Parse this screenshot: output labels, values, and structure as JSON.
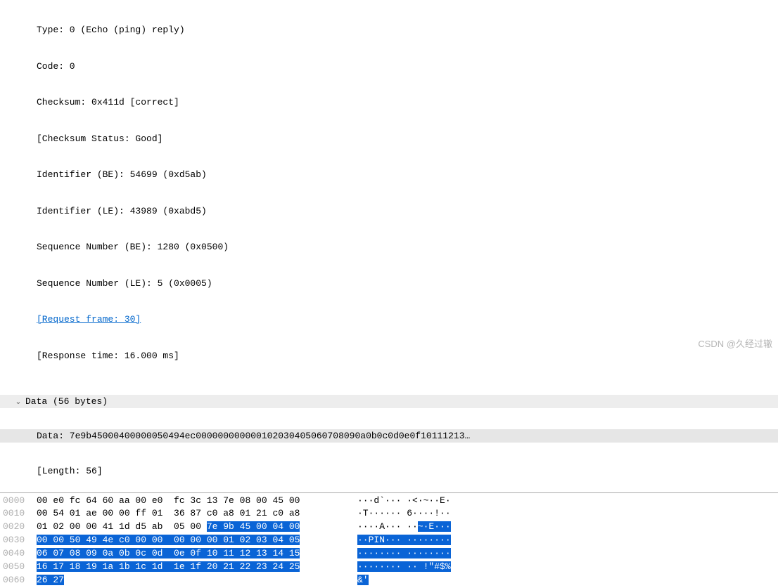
{
  "icmp": {
    "type": "Type: 0 (Echo (ping) reply)",
    "code": "Code: 0",
    "checksum": "Checksum: 0x411d [correct]",
    "checksum_status": "[Checksum Status: Good]",
    "id_be": "Identifier (BE): 54699 (0xd5ab)",
    "id_le": "Identifier (LE): 43989 (0xabd5)",
    "seq_be": "Sequence Number (BE): 1280 (0x0500)",
    "seq_le": "Sequence Number (LE): 5 (0x0005)",
    "request_frame": "[Request frame: 30]",
    "response_time": "[Response time: 16.000 ms]"
  },
  "data_section": {
    "header": "Data (56 bytes)",
    "data": "Data: 7e9b4500040000005049 4ec0000000000001020304050607 08090a0b0c0d0e0f10111213…",
    "data_compact": "Data: 7e9b45000400000050494ec000000000000102030405060708090a0b0c0d0e0f10111213…",
    "length": "[Length: 56]"
  },
  "hex": {
    "rows": [
      {
        "offset": "0000",
        "pre": "00 e0 fc 64 60 aa 00 e0  fc 3c 13 7e 08 00 45 00",
        "hl": "",
        "ascii_pre": "···d`··· ·<·~··E·",
        "ascii_hl": ""
      },
      {
        "offset": "0010",
        "pre": "00 54 01 ae 00 00 ff 01  36 87 c0 a8 01 21 c0 a8",
        "hl": "",
        "ascii_pre": "·T······ 6····!··",
        "ascii_hl": ""
      },
      {
        "offset": "0020",
        "pre": "01 02 00 00 41 1d d5 ab  05 00 ",
        "hl": "7e 9b 45 00 04 00",
        "ascii_pre": "····A··· ··",
        "ascii_hl": "~·E···"
      },
      {
        "offset": "0030",
        "pre": "",
        "hl": "00 00 50 49 4e c0 00 00  00 00 00 01 02 03 04 05",
        "ascii_pre": "",
        "ascii_hl": "··PIN··· ········"
      },
      {
        "offset": "0040",
        "pre": "",
        "hl": "06 07 08 09 0a 0b 0c 0d  0e 0f 10 11 12 13 14 15",
        "ascii_pre": "",
        "ascii_hl": "········ ········"
      },
      {
        "offset": "0050",
        "pre": "",
        "hl": "16 17 18 19 1a 1b 1c 1d  1e 1f 20 21 22 23 24 25",
        "ascii_pre": "",
        "ascii_hl": "········ ·· !\"#$%"
      },
      {
        "offset": "0060",
        "pre": "",
        "hl": "26 27",
        "ascii_pre": "",
        "ascii_hl": "&'"
      }
    ]
  },
  "watermark": "CSDN @久经过辙"
}
